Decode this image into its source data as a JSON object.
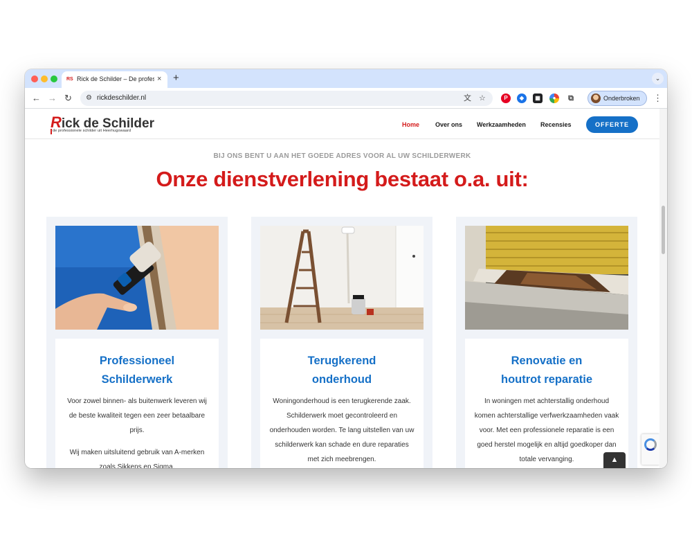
{
  "browser": {
    "tab_title": "Rick de Schilder – De professionele schilder uit Heerhugowaard",
    "tab_favicon": "RS",
    "tab_close": "×",
    "new_tab": "+",
    "tab_search": "⌄",
    "back": "←",
    "forward": "→",
    "reload": "↻",
    "site_info": "⚙",
    "url": "rickdeschilder.nl",
    "translate": "文",
    "bookmark": "☆",
    "extensions": [
      "P",
      "◆",
      "▦",
      "●",
      "⧉"
    ],
    "profile_label": "Onderbroken",
    "menu": "⋮"
  },
  "site": {
    "logo": {
      "initial": "R",
      "name_rest": "ick de Schilder",
      "tagline": "de professionele schilder uit Heerhugowaard"
    },
    "nav": [
      "Home",
      "Over ons",
      "Werkzaamheden",
      "Recensies"
    ],
    "cta": "OFFERTE",
    "kicker": "BIJ ONS BENT U AAN HET GOEDE ADRES VOOR AL UW SCHILDERWERK",
    "headline": "Onze dienstverlening bestaat o.a. uit:",
    "cards": [
      {
        "title_line1": "Professioneel",
        "title_line2": "Schilderwerk",
        "p1": "Voor zowel binnen- als buitenwerk leveren wij de beste kwaliteit tegen een zeer betaalbare prijs.",
        "p2": "Wij maken uitsluitend gebruik van A-merken zoals Sikkens en Sigma."
      },
      {
        "title_line1": "Terugkerend",
        "title_line2": "onderhoud",
        "p1": "Woningonderhoud is een terugkerende zaak. Schilderwerk moet gecontroleerd en onderhouden worden. Te lang uitstellen van uw schilderwerk kan schade en dure reparaties met zich meebrengen."
      },
      {
        "title_line1": "Renovatie en",
        "title_line2": "houtrot reparatie",
        "p1": "In woningen met achterstallig onderhoud komen achterstallige verfwerkzaamheden vaak voor. Met een professionele reparatie is een goed herstel mogelijk en altijd goedkoper dan totale vervanging."
      }
    ],
    "back_to_top": "▲",
    "colors": {
      "brand_red": "#d41b1b",
      "brand_blue": "#1570c7",
      "card_bg": "#f0f3f8"
    }
  }
}
